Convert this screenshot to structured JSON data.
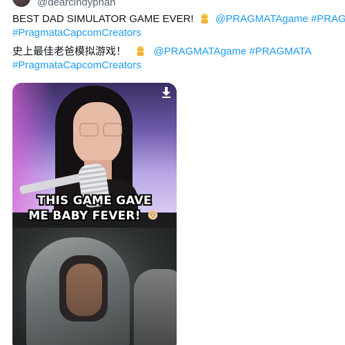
{
  "author": {
    "handle": "@dearcindyphan"
  },
  "tweet": {
    "line1_text": "BEST DAD SIMULATOR GAME EVER!",
    "line1_mention": "@PRAGMATAgame",
    "line1_hashtag": "#PRAGMATA",
    "line2_hashtag": "#PragmataCapcomCreators",
    "line3_text": "史上最佳老爸模拟游戏！",
    "line3_mention": "@PRAGMATAgame",
    "line3_hashtag": "#PRAGMATA",
    "line4_hashtag": "#PragmataCapcomCreators",
    "emoji_icon": "person-emoji-icon"
  },
  "video": {
    "caption_line1": "THIS GAME GAVE",
    "caption_line2": "ME BABY FEVER!",
    "caption_emoji_icon": "baby-emoji-icon",
    "download_icon": "download-icon"
  },
  "colors": {
    "link": "#1d9bf0",
    "text": "#0f1419",
    "secondary": "#536471"
  }
}
